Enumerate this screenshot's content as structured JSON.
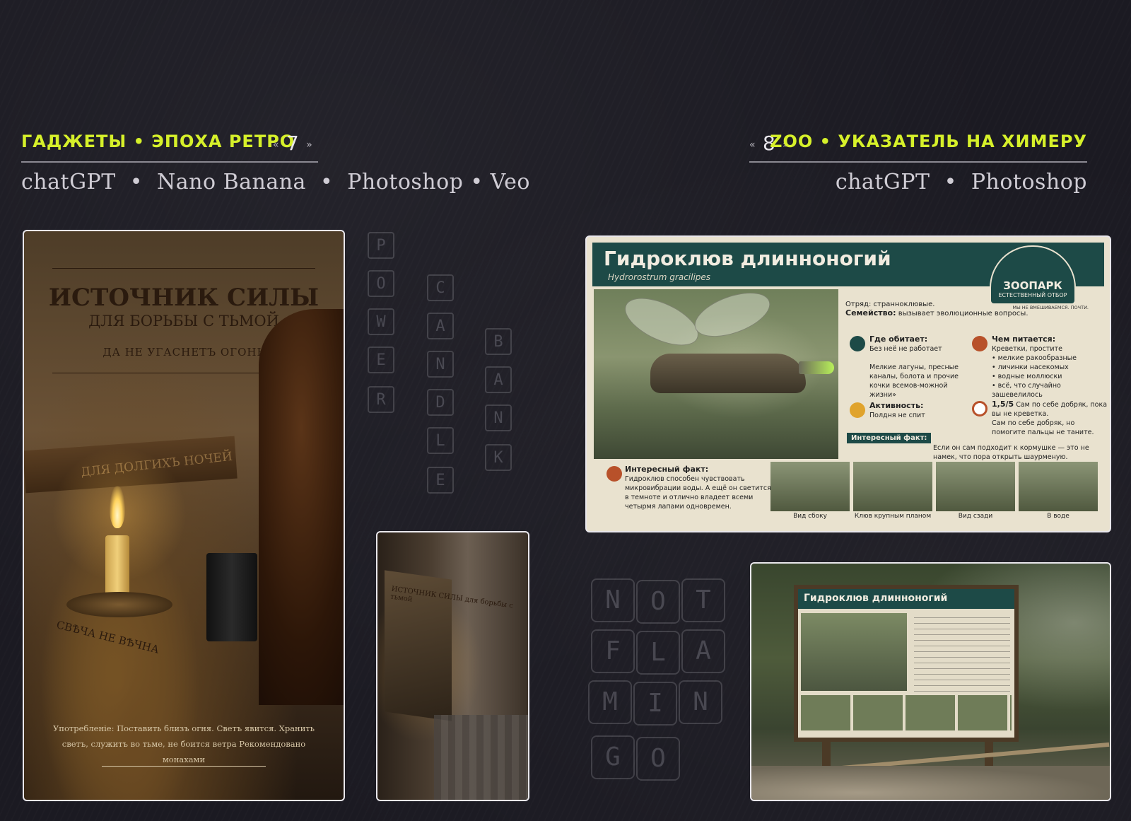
{
  "left_header": {
    "category": "ГАДЖЕТЫ • ЭПОХА РЕТРО",
    "number": "7",
    "tools": [
      "chatGPT",
      "Nano Banana",
      "Photoshop",
      "Veo"
    ]
  },
  "right_header": {
    "category": "ZOO • УКАЗАТЕЛЬ НА ХИМЕРУ",
    "number": "8",
    "tools": [
      "chatGPT",
      "Photoshop"
    ]
  },
  "stamps": {
    "power": [
      "P",
      "O",
      "W",
      "E",
      "R"
    ],
    "candle": [
      "C",
      "A",
      "N",
      "D",
      "L",
      "E"
    ],
    "bank": [
      "B",
      "A",
      "N",
      "K"
    ],
    "not": [
      "N",
      "O",
      "T"
    ],
    "fla": [
      "F",
      "L",
      "A"
    ],
    "min": [
      "M",
      "I",
      "N"
    ],
    "go": [
      "G",
      "O"
    ]
  },
  "poster": {
    "title": "ИСТОЧНИК СИЛЫ",
    "subtitle": "ДЛЯ БОРЬБЫ С ТЬМОЙ",
    "motto": "ДА НЕ УГАСНЕТЪ ОГОНЬ",
    "plank_text": "ДЛЯ ДОЛГИХЪ НОЧЕЙ",
    "arc_text": "СВѢЧА НЕ ВѢЧНА",
    "usage": "Употребленіе: Поставить близъ огня. Светъ явится. Хранить светъ, служитъ во тьме, не боится ветра Рекомендовано монахами"
  },
  "alley": {
    "sign_text": "ИСТОЧНИК СИЛЫ для борьбы с тьмой"
  },
  "zoo_sign": {
    "title": "Гидроклюв длинноногий",
    "latin": "Hydrorostrum gracilipes",
    "logo_title": "ЗООПАРК",
    "logo_sub": "ЕСТЕСТВЕННЫЙ ОТБОР",
    "logo_tagline": "МЫ НЕ ВМЕШИВАЕМСЯ. ПОЧТИ.",
    "order": "Отряд: странноклювые.",
    "family_label": "Семейство:",
    "family_value": "вызывает эволюционные вопросы.",
    "habitat_title": "Где обитает:",
    "habitat_sub": "Без неё не работает",
    "habitat_text": "Мелкие лагуны, пресные каналы, болота и прочие кочки всемов-можной жизни»",
    "food_title": "Чем питается:",
    "food_sub": "Креветки, простите",
    "food_items": [
      "мелкие ракообразные",
      "личинки насекомых",
      "водные моллюски",
      "всё, что случайно зашевелилось"
    ],
    "activity_title": "Активность:",
    "activity_text": "Полдня не спит",
    "rating": "1,5/5",
    "rating_text": "Сам по себе добряк, пока вы не креветка.",
    "rating_text2": "Сам по себе добряк, но помогите пальцы не таните.",
    "fact_badge": "Интересный факт:",
    "fact_badge_text": "Если он сам подходит к кормушке — это не намек, что пора открыть шаурменую.",
    "fact_title": "Интересный факт:",
    "fact_text": "Гидроклюв способен чувствовать микровибрации воды. А ещё он светится в темноте и отлично владеет всеми четырмя лапами одновремен.",
    "thumbs": [
      "Вид сбоку",
      "Клюв крупным планом",
      "Вид сзади",
      "В воде"
    ]
  },
  "zoo_scene": {
    "board_title": "Гидроклюв длинноногий"
  },
  "colors": {
    "accent": "#d6f02a",
    "background": "#1b1a22",
    "sign_green": "#1d4a47"
  }
}
